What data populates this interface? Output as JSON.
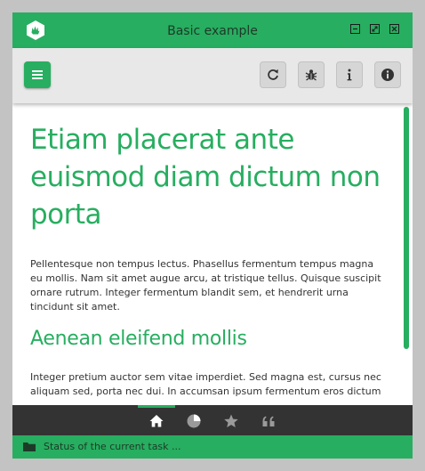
{
  "window": {
    "title": "Basic example",
    "controls": [
      "minimize-icon",
      "maximize-icon",
      "close-icon"
    ]
  },
  "toolbar": {
    "buttons": [
      "menu-icon",
      "refresh-icon",
      "bug-icon",
      "info-icon",
      "info-circle-icon"
    ]
  },
  "content": {
    "heading": "Etiam placerat ante euismod diam dictum non porta",
    "paragraph1": "Pellentesque non tempus lectus. Phasellus fermentum tempus magna eu mollis. Nam sit amet augue arcu, at tristique tellus. Quisque suscipit ornare rutrum. Integer fermentum blandit sem, et hendrerit urna tincidunt sit amet.",
    "subheading": "Aenean eleifend mollis",
    "paragraph2": "Integer pretium auctor sem vitae imperdiet. Sed magna est, cursus nec aliquam sed, porta nec dui. In accumsan ipsum fermentum eros dictum"
  },
  "bottom_nav": {
    "items": [
      "home-icon",
      "pie-chart-icon",
      "star-icon",
      "quote-icon"
    ],
    "active_item": "home-icon"
  },
  "status": {
    "icon": "folder-icon",
    "text": "Status of the current task ..."
  },
  "colors": {
    "accent": "#27ae60",
    "toolbar": "#e8e8e8",
    "nav_background": "#333333"
  }
}
